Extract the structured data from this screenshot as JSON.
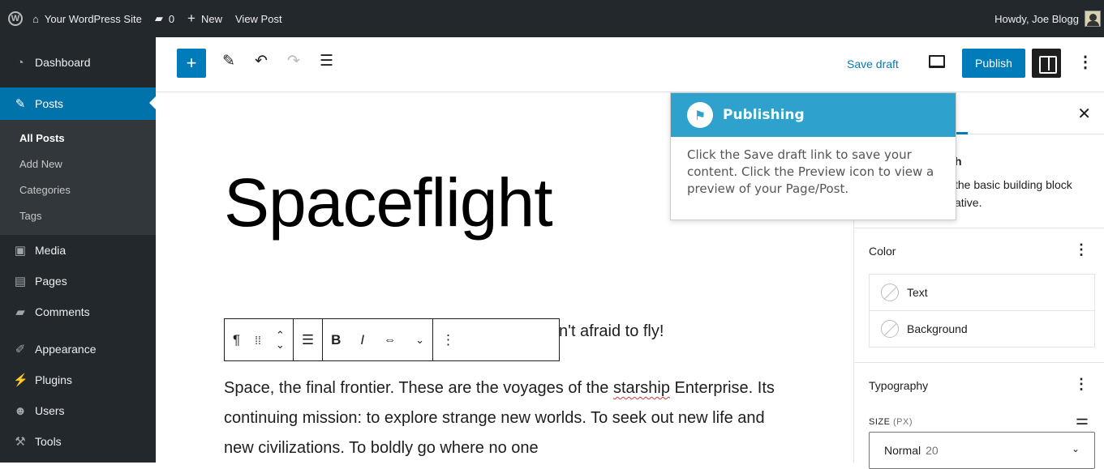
{
  "adminbar": {
    "site": "Your WordPress Site",
    "comments": "0",
    "new": "New",
    "view": "View Post",
    "howdy": "Howdy, Joe Blogg"
  },
  "sidebar": {
    "items": [
      {
        "label": "Dashboard",
        "icon": "dashboard-icon"
      },
      {
        "label": "Posts",
        "icon": "pin-icon"
      },
      {
        "label": "Media",
        "icon": "media-icon"
      },
      {
        "label": "Pages",
        "icon": "pages-icon"
      },
      {
        "label": "Comments",
        "icon": "comments-icon"
      },
      {
        "label": "Appearance",
        "icon": "brush-icon"
      },
      {
        "label": "Plugins",
        "icon": "plugin-icon"
      },
      {
        "label": "Users",
        "icon": "users-icon"
      },
      {
        "label": "Tools",
        "icon": "wrench-icon"
      }
    ],
    "submenu": [
      "All Posts",
      "Add New",
      "Categories",
      "Tags"
    ]
  },
  "toolbar": {
    "save_draft": "Save draft",
    "publish": "Publish"
  },
  "post": {
    "title": "Spaceflight",
    "subheading": "n't afraid to fly!",
    "body_pre": "Space, the final frontier. These are the voyages of the ",
    "body_word": "starship",
    "body_rest": " Enterprise. Its continuing mission: to explore strange new worlds. To seek out new life and new civilizations. To boldly go where no one"
  },
  "panel": {
    "block_name": "h",
    "block_desc_1": "the basic building block",
    "block_desc_2": "ative.",
    "color_title": "Color",
    "color_text": "Text",
    "color_bg": "Background",
    "typography_title": "Typography",
    "size_label": "SIZE",
    "size_unit": "(PX)",
    "size_value": "Normal",
    "size_num": "20"
  },
  "tooltip": {
    "title": "Publishing",
    "body": "Click the Save draft link to save your content. Click the Preview icon to view a preview of your Page/Post."
  },
  "colors": {
    "adminbar": "#23282d",
    "accent": "#007cba",
    "tooltip_header": "#2ea2cc"
  }
}
